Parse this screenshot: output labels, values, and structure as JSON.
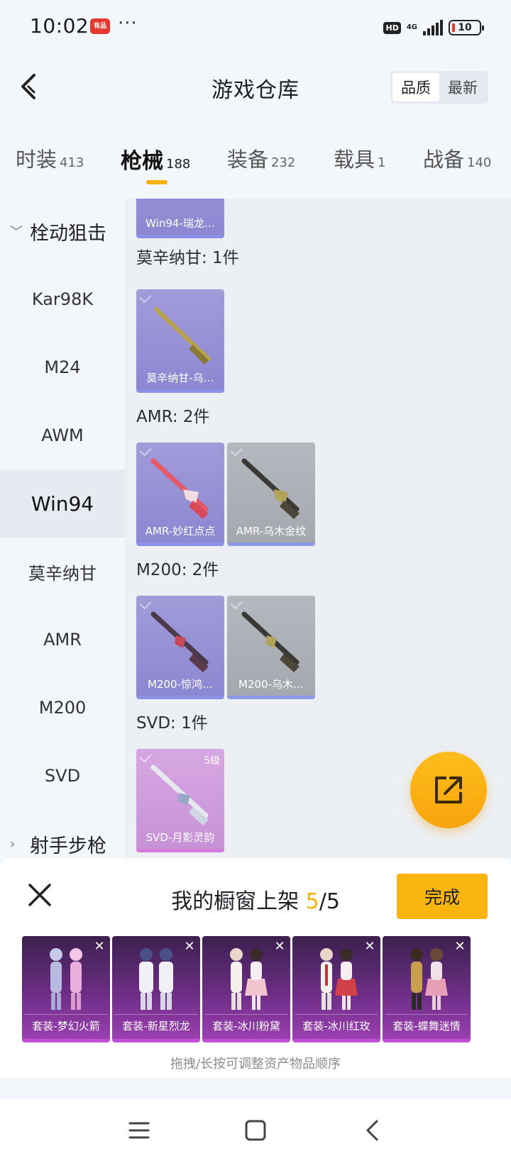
{
  "status_bar": {
    "time": "10:02",
    "app_badge": "有品",
    "more": "···",
    "hd": "HD",
    "network": "4G",
    "battery": "10"
  },
  "header": {
    "title": "游戏仓库",
    "sort_options": [
      "品质",
      "最新"
    ],
    "sort_active": "品质"
  },
  "category_tabs": [
    {
      "label": "时装",
      "count": "413"
    },
    {
      "label": "枪械",
      "count": "188",
      "active": true
    },
    {
      "label": "装备",
      "count": "232"
    },
    {
      "label": "载具",
      "count": "1"
    },
    {
      "label": "战备",
      "count": "140"
    }
  ],
  "sidebar": {
    "group_expanded": "栓动狙击",
    "items": [
      "Kar98K",
      "M24",
      "AWM",
      "Win94",
      "莫辛纳甘",
      "AMR",
      "M200",
      "SVD"
    ],
    "active_item": "Win94",
    "group_collapsed": "射手步枪"
  },
  "content": {
    "top_card": {
      "name": "Win94-瑞龙…"
    },
    "groups": [
      {
        "title": "莫辛纳甘: 1件",
        "cards": [
          {
            "name": "莫辛纳甘-乌…",
            "tone": "purple"
          }
        ]
      },
      {
        "title": "AMR: 2件",
        "cards": [
          {
            "name": "AMR-妙红点点",
            "tone": "purple"
          },
          {
            "name": "AMR-乌木金纹",
            "tone": "grey"
          }
        ]
      },
      {
        "title": "M200: 2件",
        "cards": [
          {
            "name": "M200-惊鸿…",
            "tone": "purple"
          },
          {
            "name": "M200-乌木…",
            "tone": "grey"
          }
        ]
      },
      {
        "title": "SVD: 1件",
        "cards": [
          {
            "name": "SVD-月影灵韵",
            "tone": "pink",
            "level": "5级"
          }
        ]
      }
    ]
  },
  "showcase": {
    "title_prefix": "我的橱窗上架 ",
    "used": "5",
    "separator": "/",
    "total": "5",
    "done_label": "完成",
    "slots": [
      "套装-梦幻火箭",
      "套装-新星烈龙",
      "套装-冰川粉黛",
      "套装-冰川红玫",
      "套装-蝶舞迷情"
    ],
    "hint": "拖拽/长按可调整资产物品顺序"
  },
  "colors": {
    "accent": "#f9b40f",
    "card_purple": "#8c87d2",
    "card_grey": "#a5a8af",
    "card_pink": "#c792d6",
    "slot_purple": "#6c2d84"
  }
}
